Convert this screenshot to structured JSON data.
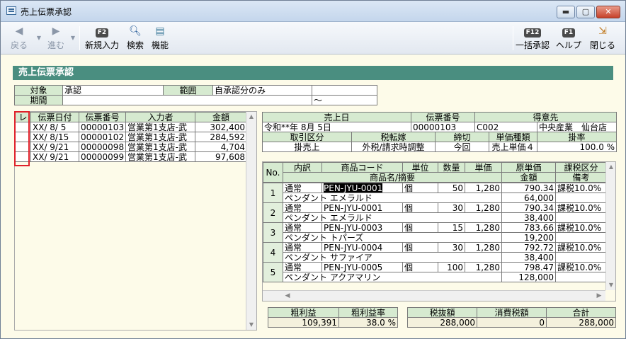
{
  "window": {
    "title": "売上伝票承認",
    "min": "▬",
    "max": "▢",
    "close": "✕"
  },
  "toolbar": {
    "back": "戻る",
    "forward": "進む",
    "new": "新規入力",
    "new_key": "F2",
    "search": "検索",
    "func": "機能",
    "bulk": "一括承認",
    "bulk_key": "F12",
    "help": "ヘルプ",
    "help_key": "F1",
    "close": "閉じる"
  },
  "header": "売上伝票承認",
  "filter": {
    "target_label": "対象",
    "target_value": "承認",
    "range_label": "範囲",
    "range_value": "自承認分のみ",
    "period_label": "期間",
    "period_sep": "～"
  },
  "list": {
    "headers": [
      "レ",
      "伝票日付",
      "伝票番号",
      "入力者",
      "金額"
    ],
    "rows": [
      {
        "date": "XX/ 8/ 5",
        "no": "00000103",
        "user": "営業第1支店-武",
        "amount": "302,400"
      },
      {
        "date": "XX/ 8/15",
        "no": "00000102",
        "user": "営業第1支店-武",
        "amount": "284,592"
      },
      {
        "date": "XX/ 9/21",
        "no": "00000098",
        "user": "営業第1支店-武",
        "amount": "4,704"
      },
      {
        "date": "XX/ 9/21",
        "no": "00000099",
        "user": "営業第1支店-武",
        "amount": "97,608"
      }
    ]
  },
  "detail": {
    "h_sales_date": "売上日",
    "h_slip_no": "伝票番号",
    "h_customer": "得意先",
    "sales_date": "令和**年 8月 5日",
    "slip_no": "00000103",
    "cust_code": "C002",
    "cust_name": "中央産業　仙台店",
    "h_trade": "取引区分",
    "h_tax": "税転嫁",
    "h_close": "締切",
    "h_price_type": "単価種類",
    "h_rate": "掛率",
    "trade": "掛売上",
    "tax": "外税/請求時調整",
    "close": "今回",
    "price_type": "売上単価４",
    "rate": "100.0 %"
  },
  "lines": {
    "h_no": "No.",
    "h_kind": "内訳",
    "h_code": "商品コード",
    "h_unit": "単位",
    "h_qty": "数量",
    "h_price": "単価",
    "h_cost": "原単価",
    "h_taxcls": "課税区分",
    "h_name": "商品名/摘要",
    "h_amount": "金額",
    "h_note": "備考",
    "rows": [
      {
        "no": "1",
        "kind": "通常",
        "code": "PEN-JYU-0001",
        "unit": "個",
        "qty": "50",
        "price": "1,280",
        "cost": "790.34",
        "taxcls": "課税10.0%",
        "name": "ペンダント エメラルド",
        "amount": "64,000"
      },
      {
        "no": "2",
        "kind": "通常",
        "code": "PEN-JYU-0001",
        "unit": "個",
        "qty": "30",
        "price": "1,280",
        "cost": "790.34",
        "taxcls": "課税10.0%",
        "name": "ペンダント エメラルド",
        "amount": "38,400"
      },
      {
        "no": "3",
        "kind": "通常",
        "code": "PEN-JYU-0003",
        "unit": "個",
        "qty": "15",
        "price": "1,280",
        "cost": "783.66",
        "taxcls": "課税10.0%",
        "name": "ペンダント トパーズ",
        "amount": "19,200"
      },
      {
        "no": "4",
        "kind": "通常",
        "code": "PEN-JYU-0004",
        "unit": "個",
        "qty": "30",
        "price": "1,280",
        "cost": "792.72",
        "taxcls": "課税10.0%",
        "name": "ペンダント サファイア",
        "amount": "38,400"
      },
      {
        "no": "5",
        "kind": "通常",
        "code": "PEN-JYU-0005",
        "unit": "個",
        "qty": "100",
        "price": "1,280",
        "cost": "798.47",
        "taxcls": "課税10.0%",
        "name": "ペンダント アクアマリン",
        "amount": "128,000"
      }
    ]
  },
  "totals": {
    "h_profit": "粗利益",
    "h_profit_rate": "粗利益率",
    "profit": "109,391",
    "profit_rate": "38.0 %",
    "h_net": "税抜額",
    "h_tax": "消費税額",
    "h_total": "合計",
    "net": "288,000",
    "tax": "0",
    "total": "288,000"
  }
}
